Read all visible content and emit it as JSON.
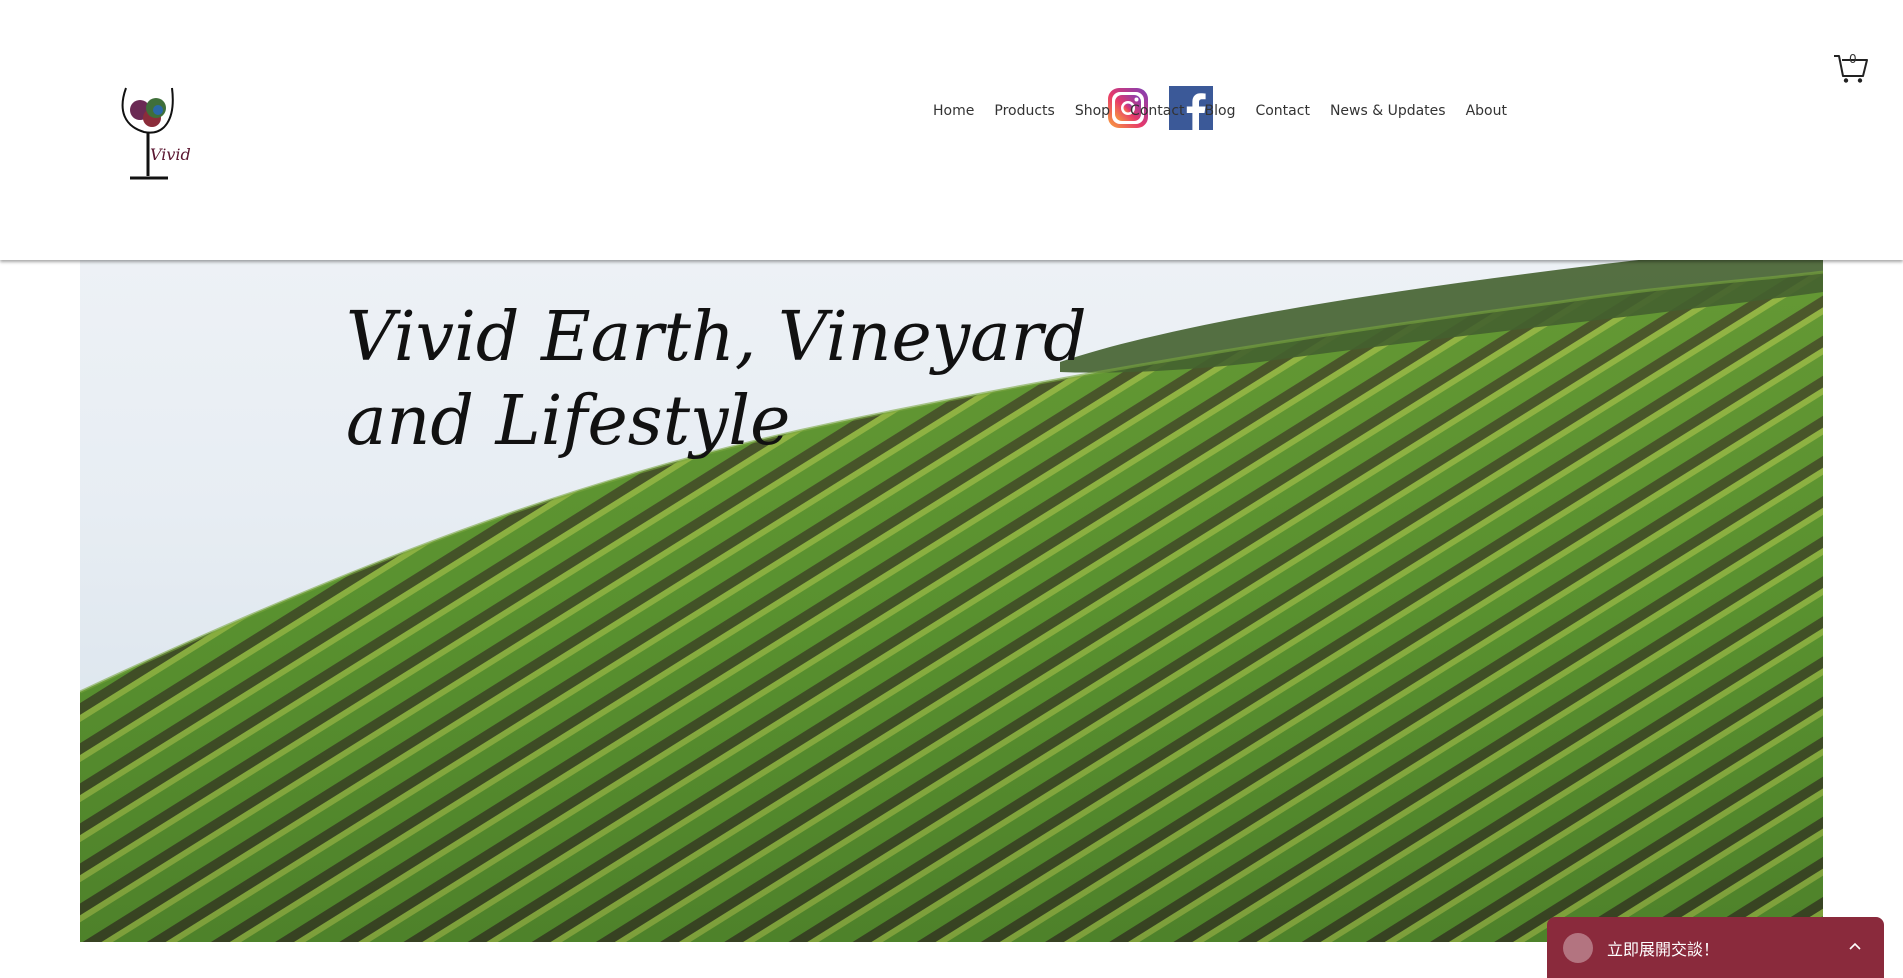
{
  "brand": {
    "logo_name": "Vivid",
    "logo_icon": "wine-glass-globe-logo"
  },
  "social": [
    {
      "name": "Instagram",
      "icon": "instagram-icon"
    },
    {
      "name": "Facebook",
      "icon": "facebook-icon"
    }
  ],
  "nav": {
    "items": [
      "Home",
      "Products",
      "Shop",
      "Contact",
      "Blog",
      "Contact",
      "News & Updates",
      "About"
    ]
  },
  "cart": {
    "count": "0",
    "icon": "cart-icon"
  },
  "hero": {
    "title_line1": "Vivid Earth, Vineyard",
    "title_line2": "and Lifestyle"
  },
  "chat": {
    "label": "立即展開交談！",
    "icon": "chat-face-icon",
    "toggle_icon": "chevron-up-icon",
    "color": "#8a2a3c"
  },
  "colors": {
    "header_bg": "#ffffff",
    "facebook_blue": "#3b5998",
    "vineyard_green": "#5a8f2e"
  }
}
